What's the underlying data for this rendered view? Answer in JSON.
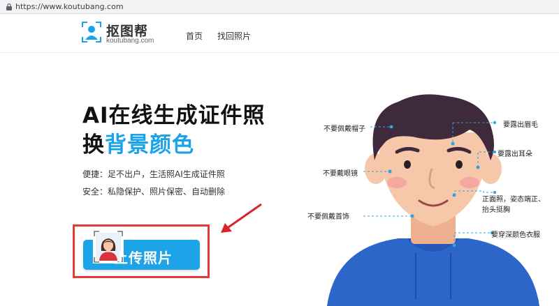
{
  "browser": {
    "url": "https://www.koutubang.com"
  },
  "header": {
    "logo_title": "抠图帮",
    "logo_subtitle": "koutubang.com",
    "nav": {
      "home": "首页",
      "find_photo": "找回照片"
    }
  },
  "hero": {
    "line1": "AI在线生成证件照",
    "line2_prefix": "换",
    "line2_highlight": "背景颜色",
    "feature1": "便捷：足不出户，生活照AI生成证件照",
    "feature2": "安全：私隐保护、照片保密、自动删除",
    "upload_label": "上传照片"
  },
  "annotations": {
    "no_hat": "不要佩戴帽子",
    "show_eyebrows": "要露出眉毛",
    "show_ears": "要露出耳朵",
    "no_glasses": "不要戴眼镜",
    "front_pose_1": "正面照，姿态端正、",
    "front_pose_2": "抬头挺胸",
    "no_jewelry": "不要佩戴首饰",
    "dark_clothes": "要穿深颜色衣服"
  },
  "colors": {
    "accent": "#1da3e7",
    "highlight_box": "#e53935",
    "hair": "#3f2a3c",
    "shirt": "#2c66c8",
    "skin": "#f6c7a8"
  }
}
